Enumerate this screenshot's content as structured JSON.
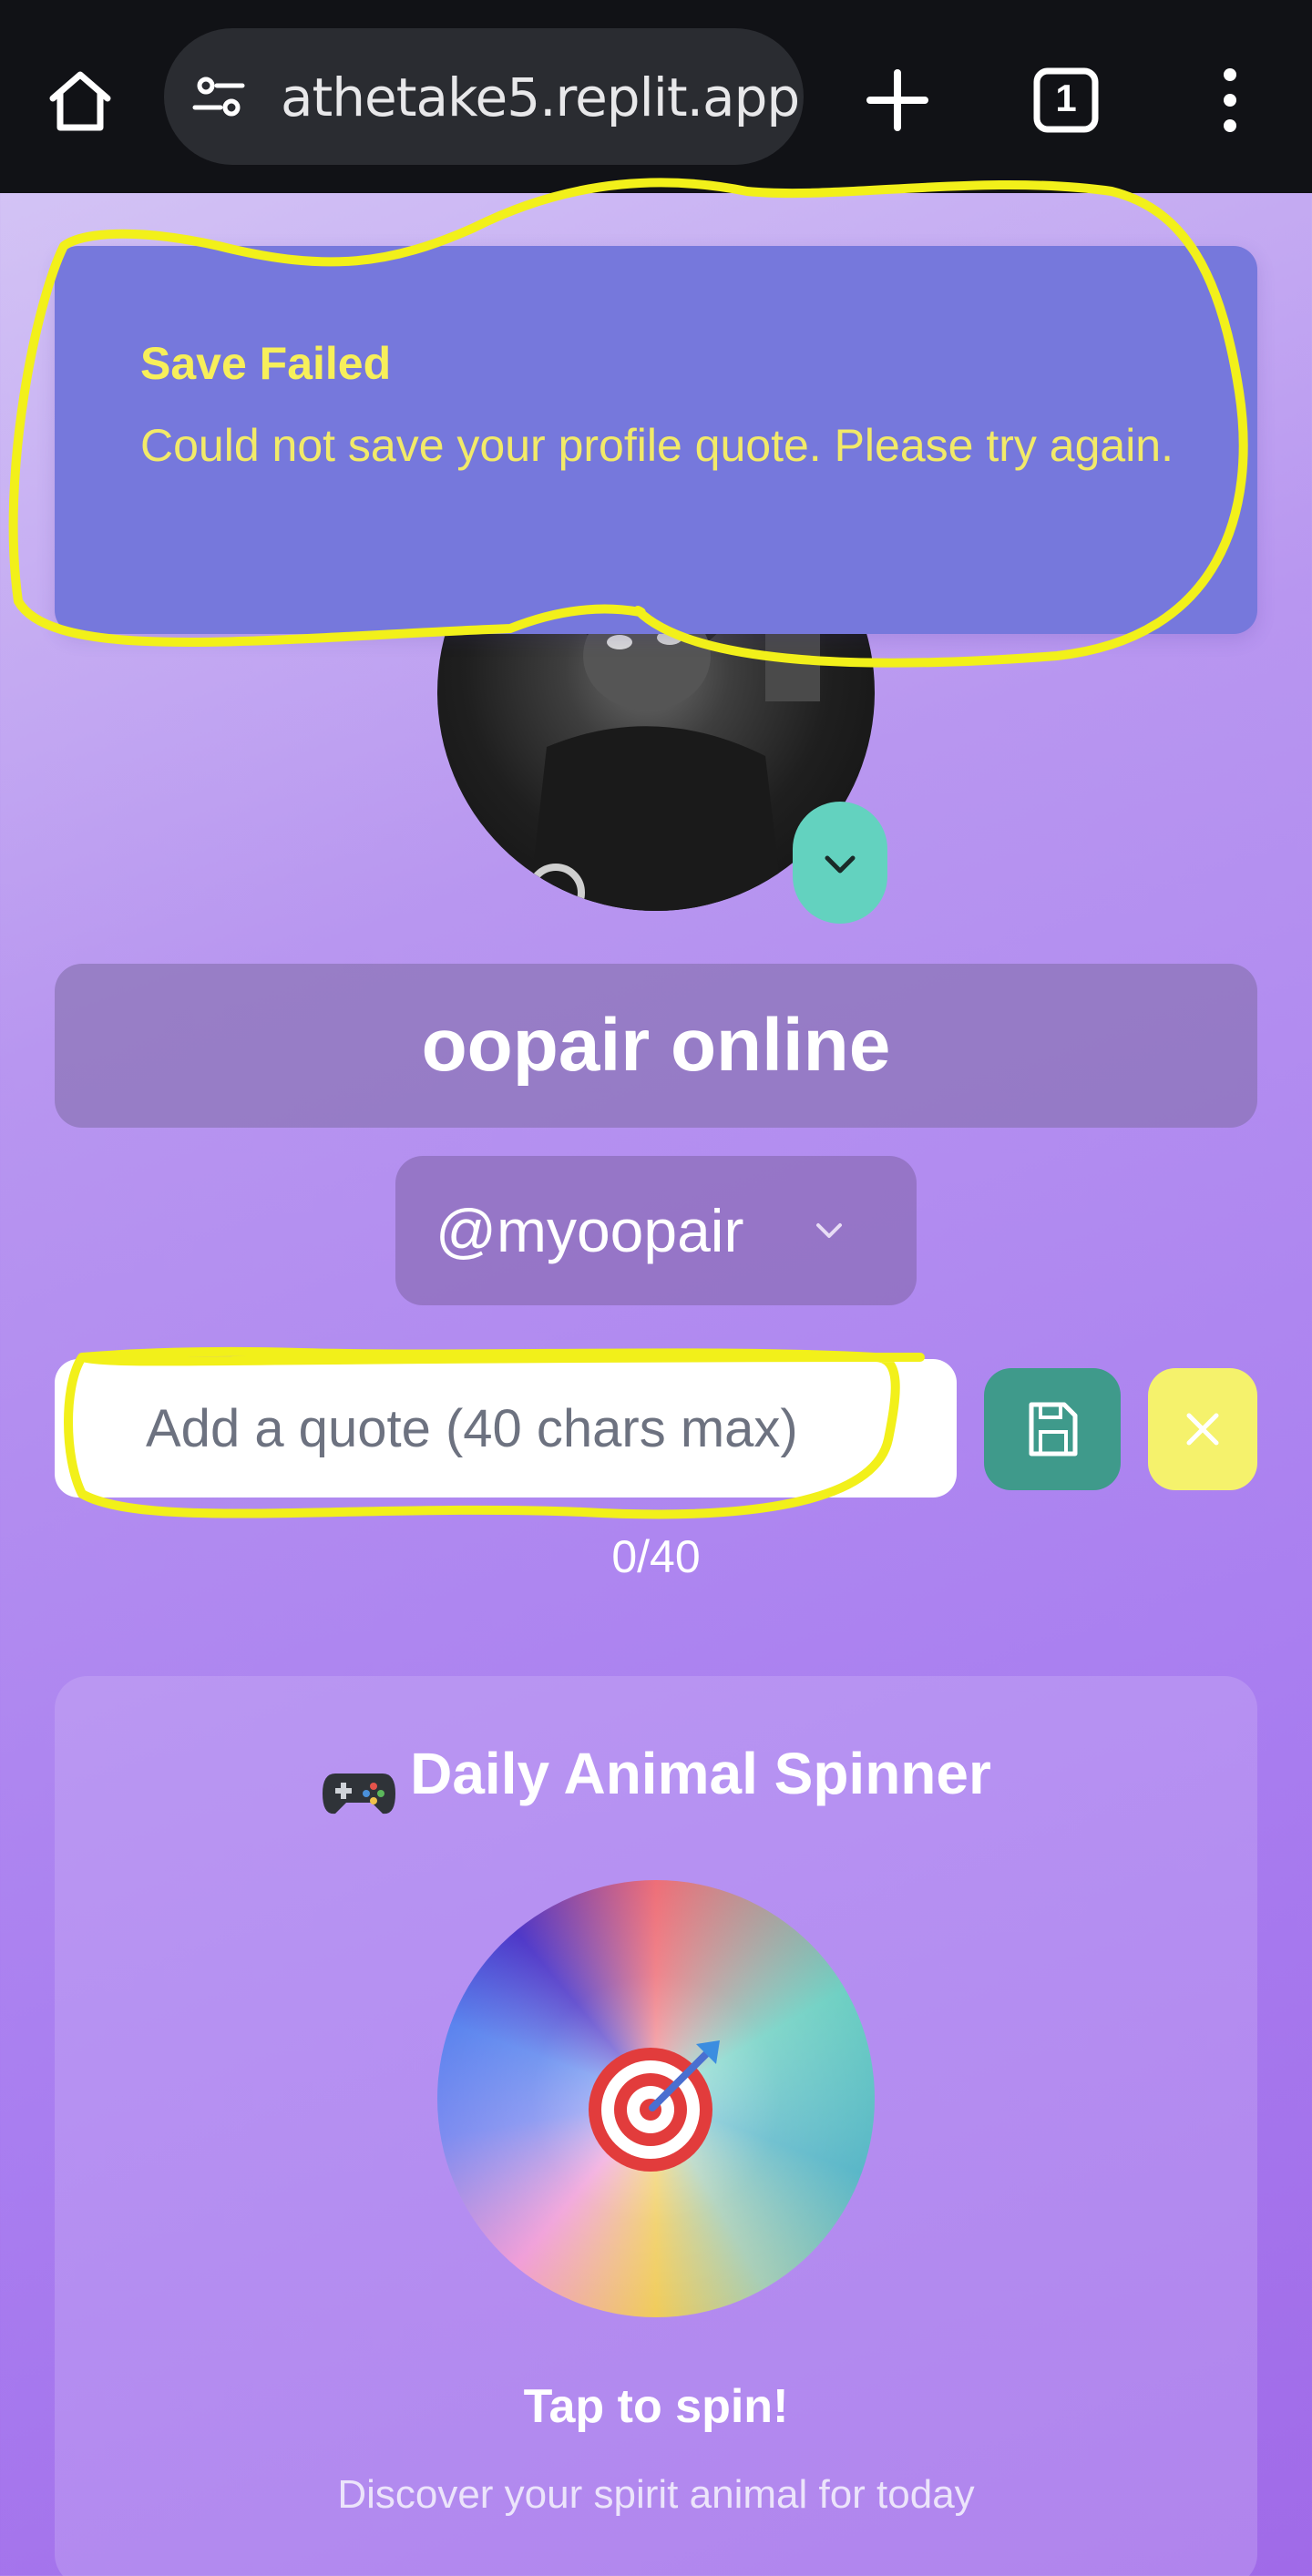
{
  "browser": {
    "url": "athetake5.replit.app",
    "tab_count": "1"
  },
  "toast": {
    "title": "Save Failed",
    "message": "Could not save your profile quote. Please try again."
  },
  "profile": {
    "display_name": "oopair online",
    "handle": "@myoopair"
  },
  "quote": {
    "placeholder": "Add a quote (40 chars max)",
    "value": "",
    "counter": "0/40"
  },
  "spinner": {
    "title": "Daily Animal Spinner",
    "tap_label": "Tap to spin!",
    "subtitle": "Discover your spirit animal for today"
  },
  "colors": {
    "annotation": "#f2f01a",
    "toast_bg": "#7678dc",
    "toast_text": "#f7ef5a",
    "save_button": "#3f9a8b",
    "cancel_button": "#f5f26c",
    "avatar_toggle": "#63d2bf"
  },
  "icons": [
    "home-icon",
    "site-settings-icon",
    "plus-icon",
    "tabs-icon",
    "more-vert-icon",
    "chevron-down-icon",
    "save-disk-icon",
    "close-icon",
    "gamepad-icon",
    "target-icon"
  ]
}
